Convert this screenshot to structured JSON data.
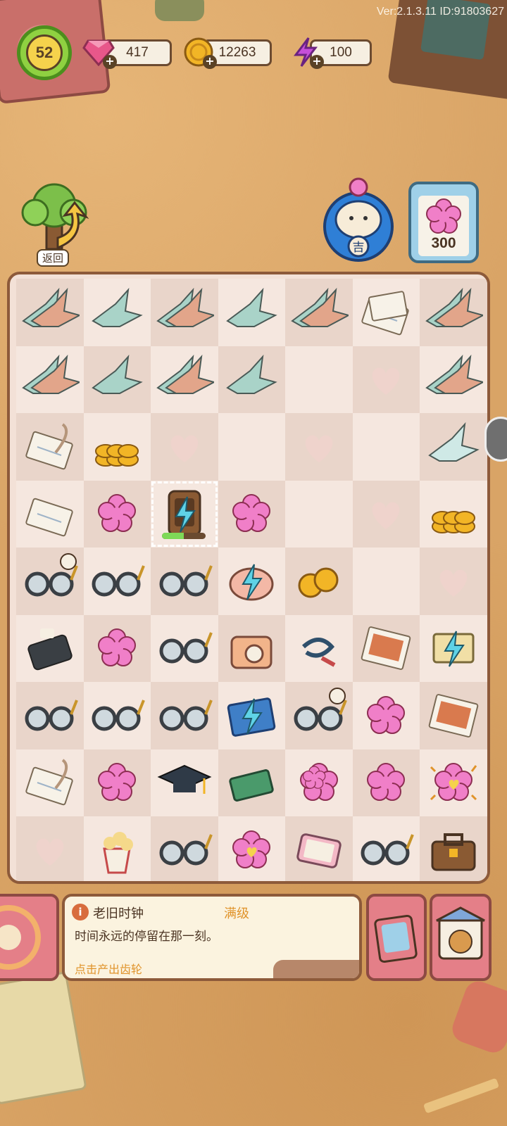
{
  "version_text": "Ver:2.1.3.11 ID:91803627",
  "hud": {
    "level": "52",
    "gems": "417",
    "coins": "12263",
    "energy": "100"
  },
  "nav": {
    "back_label": "返回",
    "clipboard_count": "300",
    "daruma_char": "吉"
  },
  "board": {
    "rows": [
      [
        "crane-pair",
        "crane",
        "crane-pair",
        "crane",
        "crane-pair",
        "letters",
        "crane-pair"
      ],
      [
        "crane-pair",
        "crane",
        "crane-pair",
        "crane",
        "empty",
        "heart",
        "crane-pair"
      ],
      [
        "letter-quill",
        "coin-pile",
        "heart",
        "empty",
        "heart",
        "empty",
        "crane-single"
      ],
      [
        "letter",
        "flower",
        "clock-generator",
        "flower",
        "empty",
        "heart",
        "coin-stack"
      ],
      [
        "glasses-timer",
        "glasses",
        "glasses",
        "piggy-bank",
        "coins",
        "empty",
        "heart"
      ],
      [
        "phone",
        "flower",
        "glasses",
        "camera",
        "cord",
        "photo",
        "piano"
      ],
      [
        "glasses",
        "glasses",
        "glasses",
        "book",
        "glasses-timer",
        "flower",
        "photo"
      ],
      [
        "letter-quill",
        "flower",
        "grad-cap",
        "card",
        "flower-double",
        "flower",
        "flower-heart-sparkle"
      ],
      [
        "heart",
        "popcorn",
        "glasses",
        "flower-heart",
        "tablet",
        "glasses",
        "bag"
      ]
    ],
    "selected_progress": 0.5
  },
  "info": {
    "item_name": "老旧时钟",
    "max_level": "满级",
    "description": "时间永远的停留在那一刻。",
    "action": "点击产出齿轮"
  },
  "colors": {
    "gem": "#e8578a",
    "coin": "#f2b526",
    "energy": "#c64fd9",
    "flower": "#f07fc8",
    "crane": "#a9d3c8",
    "accent": "#8d5a3a"
  }
}
